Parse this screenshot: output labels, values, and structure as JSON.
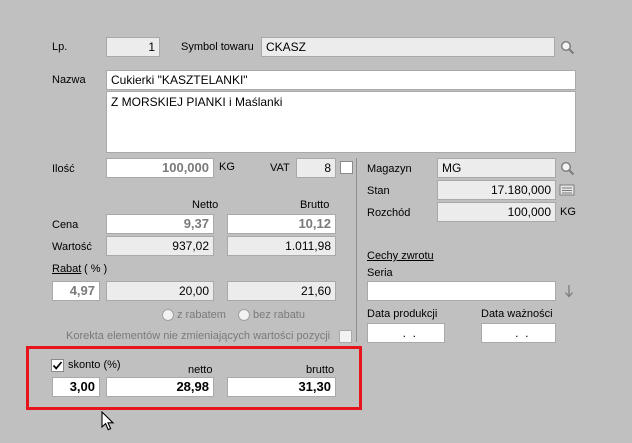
{
  "lp": {
    "label": "Lp.",
    "value": "1"
  },
  "symbol": {
    "label": "Symbol towaru",
    "value": "CKASZ"
  },
  "nazwa": {
    "label": "Nazwa",
    "line1": "Cukierki \"KASZTELANKI\"",
    "line2": "Z MORSKIEJ PIANKI i Maślanki"
  },
  "ilosc": {
    "label": "Ilość",
    "value": "100,000",
    "unit": "KG"
  },
  "vat": {
    "label": "VAT",
    "value": "8"
  },
  "columns": {
    "netto": "Netto",
    "brutto": "Brutto"
  },
  "cena": {
    "label": "Cena",
    "netto": "9,37",
    "brutto": "10,12"
  },
  "wartosc": {
    "label": "Wartość",
    "netto": "937,02",
    "brutto": "1.011,98"
  },
  "rabat": {
    "label": "Rabat",
    "unit": "( % )",
    "percent": "4,97",
    "netto": "20,00",
    "brutto": "21,60"
  },
  "radios": {
    "z_rabatem": "z rabatem",
    "bez_rabatu": "bez rabatu"
  },
  "korekta": {
    "label": "Korekta elementów nie zmieniających wartości pozycji"
  },
  "skonto": {
    "label": "skonto (%)",
    "netto_label": "netto",
    "brutto_label": "brutto",
    "percent": "3,00",
    "netto": "28,98",
    "brutto": "31,30"
  },
  "magazyn": {
    "label": "Magazyn",
    "value": "MG"
  },
  "stan": {
    "label": "Stan",
    "value": "17.180,000"
  },
  "rozchod": {
    "label": "Rozchód",
    "value": "100,000",
    "unit": "KG"
  },
  "cechy": {
    "label": "Cechy zwrotu"
  },
  "seria": {
    "label": "Seria",
    "value": ""
  },
  "data_produkcji": {
    "label": "Data produkcji",
    "value": "  .  ."
  },
  "data_waznosci": {
    "label": "Data ważności",
    "value": "  .  ."
  },
  "icons": {
    "search": "search-icon",
    "stock": "stock-list-icon",
    "arrow": "arrow-down-icon",
    "cursor": "mouse-pointer-icon"
  },
  "colors": {
    "highlight": "#e8141c",
    "background": "#c0c0c0"
  }
}
